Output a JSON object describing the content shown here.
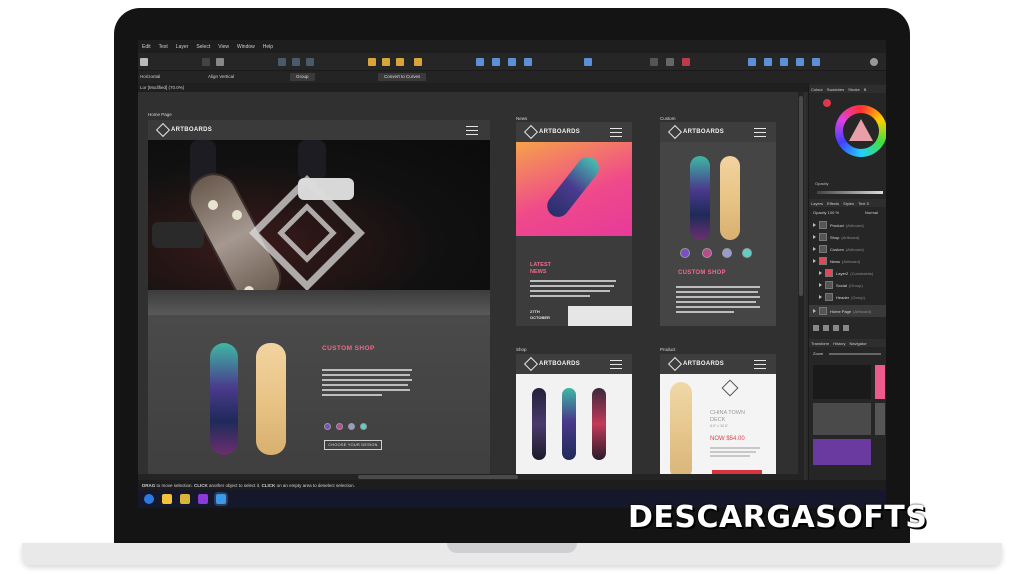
{
  "menu": [
    "Edit",
    "Text",
    "Layer",
    "Select",
    "View",
    "Window",
    "Help"
  ],
  "toolbar": {
    "horizontal_label": "Horizontal",
    "vertical_label": "Align Vertical",
    "group_label": "Group",
    "convert_label": "Convert to Curves"
  },
  "document_tab": "Lor [Modified] (70.0%)",
  "artboards": {
    "home": {
      "label": "Home Page",
      "logo": "ARTBOARDS",
      "section_title": "CUSTOM SHOP",
      "cta": "CHOOSE YOUR DESIGN",
      "swatch_colors": [
        "#7a4fc4",
        "#b74b8e",
        "#9a9ad0",
        "#5bd1c6"
      ]
    },
    "news": {
      "label": "News",
      "logo": "ARTBOARDS",
      "heading_line1": "LATEST",
      "heading_line2": "NEWS",
      "date_line1": "27TH",
      "date_line2": "OCTOBER"
    },
    "custom": {
      "label": "Custom",
      "logo": "ARTBOARDS",
      "title": "CUSTOM SHOP",
      "swatch_colors": [
        "#7a4fc4",
        "#b74b8e",
        "#9a9ad0",
        "#5bd1c6"
      ]
    },
    "shop": {
      "label": "Shop",
      "logo": "ARTBOARDS"
    },
    "product": {
      "label": "Product",
      "logo": "ARTBOARDS",
      "name_line1": "CHINA TOWN",
      "name_line2": "DECK",
      "name_line3": "8.0\" x 30.5\"",
      "price": "NOW $54.00"
    }
  },
  "panel": {
    "top_tabs": [
      "Colour",
      "Swatches",
      "Stroke",
      "B"
    ],
    "opacity_label": "Opacity",
    "layer_tabs": [
      "Layers",
      "Effects",
      "Styles",
      "Text S"
    ],
    "layer_opacity": "Opacity 100 %",
    "layer_blend": "Normal",
    "layers": [
      {
        "name": "Product",
        "kind": "(Artboard)"
      },
      {
        "name": "Shop",
        "kind": "(Artboard)"
      },
      {
        "name": "Custom",
        "kind": "(Artboard)"
      },
      {
        "name": "News",
        "kind": "(Artboard)"
      },
      {
        "name": "Layer2",
        "kind": "(Constraints)"
      },
      {
        "name": "Social",
        "kind": "(Group)"
      },
      {
        "name": "Header",
        "kind": "(Group)"
      },
      {
        "name": "Home Page",
        "kind": "(Artboard)"
      }
    ],
    "bottom_tabs": [
      "Transform",
      "History",
      "Navigator"
    ],
    "zoom_label": "Zoom"
  },
  "status": {
    "drag": "DRAG",
    "text1": " to move selection. ",
    "click1": "CLICK",
    "text2": " another object to select it. ",
    "click2": "CLICK",
    "text3": " on an empty area to deselect selection."
  },
  "watermark": "DESCARGASOFTS"
}
